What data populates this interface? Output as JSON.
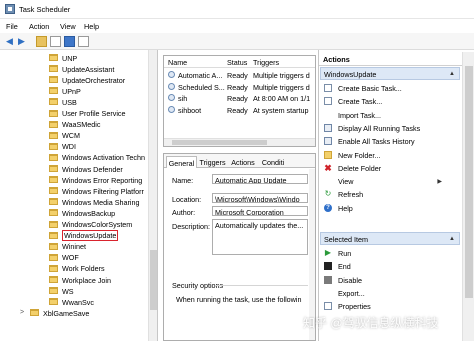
{
  "window": {
    "title": "Task Scheduler"
  },
  "menu": [
    "File",
    "Action",
    "View",
    "Help"
  ],
  "tree": {
    "items": [
      {
        "label": "UNP"
      },
      {
        "label": "UpdateAssistant"
      },
      {
        "label": "UpdateOrchestrator"
      },
      {
        "label": "UPnP"
      },
      {
        "label": "USB"
      },
      {
        "label": "User Profile Service"
      },
      {
        "label": "WaaSMedic"
      },
      {
        "label": "WCM"
      },
      {
        "label": "WDI"
      },
      {
        "label": "Windows Activation Techn"
      },
      {
        "label": "Windows Defender"
      },
      {
        "label": "Windows Error Reporting"
      },
      {
        "label": "Windows Filtering Platforr"
      },
      {
        "label": "Windows Media Sharing"
      },
      {
        "label": "WindowsBackup"
      },
      {
        "label": "WindowsColorSystem"
      },
      {
        "label": "WindowsUpdate",
        "selected": true
      },
      {
        "label": "Wininet"
      },
      {
        "label": "WOF"
      },
      {
        "label": "Work Folders"
      },
      {
        "label": "Workplace Join"
      },
      {
        "label": "WS"
      },
      {
        "label": "WwanSvc"
      },
      {
        "label": "XblGameSave",
        "top": true,
        "expander": ">"
      }
    ]
  },
  "tasks": {
    "headers": {
      "name": "Name",
      "status": "Status",
      "triggers": "Triggers"
    },
    "rows": [
      {
        "name": "Automatic A...",
        "status": "Ready",
        "triggers": "Multiple triggers d"
      },
      {
        "name": "Scheduled S...",
        "status": "Ready",
        "triggers": "Multiple triggers d"
      },
      {
        "name": "sih",
        "status": "Ready",
        "triggers": "At 8:00 AM on 1/1"
      },
      {
        "name": "sihboot",
        "status": "Ready",
        "triggers": "At system startup"
      }
    ]
  },
  "props": {
    "tabs": [
      "General",
      "Triggers",
      "Actions",
      "Conditi"
    ],
    "name_label": "Name:",
    "name_value": "Automatic App Update",
    "location_label": "Location:",
    "location_value": "\\Microsoft\\Windows\\Windo",
    "author_label": "Author:",
    "author_value": "Microsoft Corporation",
    "description_label": "Description:",
    "description_value": "Automatically updates the...",
    "security_label": "Security options",
    "security_text": "When running the task, use the followin"
  },
  "actions": {
    "header": "Actions",
    "group1": "WindowsUpdate",
    "items1": [
      {
        "label": "Create Basic Task...",
        "icon": "page"
      },
      {
        "label": "Create Task...",
        "icon": "page"
      },
      {
        "label": "Import Task...",
        "icon": "none"
      },
      {
        "label": "Display All Running Tasks",
        "icon": "list"
      },
      {
        "label": "Enable All Tasks History",
        "icon": "list"
      },
      {
        "label": "New Folder...",
        "icon": "folder"
      },
      {
        "label": "Delete Folder",
        "icon": "red"
      },
      {
        "label": "View",
        "icon": "none",
        "submenu": true
      },
      {
        "label": "Refresh",
        "icon": "refresh"
      },
      {
        "label": "Help",
        "icon": "help"
      }
    ],
    "group2": "Selected Item",
    "items2": [
      {
        "label": "Run",
        "icon": "green"
      },
      {
        "label": "End",
        "icon": "stop"
      },
      {
        "label": "Disable",
        "icon": "down"
      },
      {
        "label": "Export...",
        "icon": "none"
      },
      {
        "label": "Properties",
        "icon": "page"
      }
    ]
  },
  "watermark": "知乎 @驾驭信息纵横科技"
}
